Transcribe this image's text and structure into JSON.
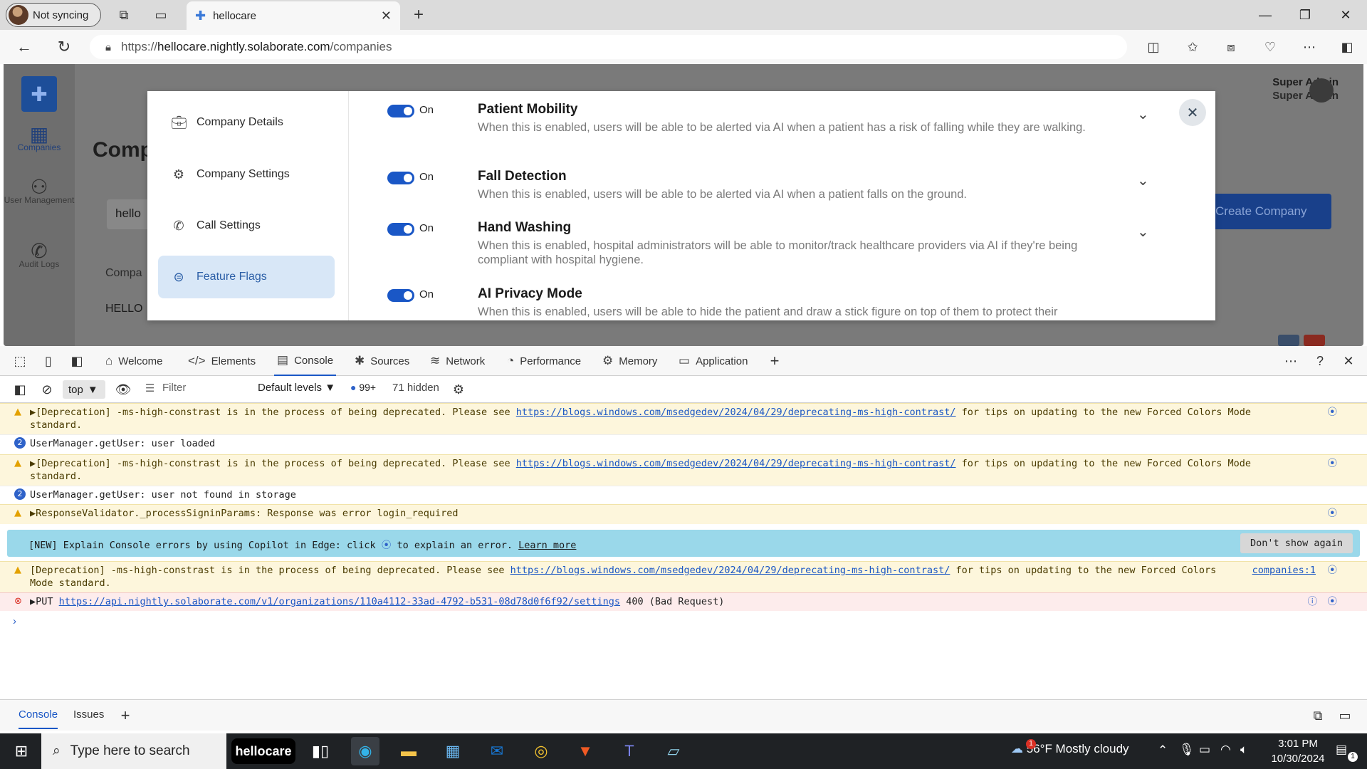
{
  "browser": {
    "profile_label": "Not syncing",
    "tab_title": "hellocare",
    "url_scheme": "https://",
    "url_host": "hellocare.nightly.solaborate.com",
    "url_path": "/companies"
  },
  "app": {
    "nav": [
      {
        "label": "Companies",
        "icon": "building-icon"
      },
      {
        "label": "User Management",
        "icon": "users-icon"
      },
      {
        "label": "Audit Logs",
        "icon": "phone-log-icon"
      }
    ],
    "page_title": "Comp",
    "search_value": "hello",
    "create_button": "Create Company",
    "table_header_fragment": "Compa",
    "row_fragment": "HELLO",
    "user_name": "Super Admin",
    "user_role": "Super Admin"
  },
  "modal": {
    "sidebar": [
      {
        "label": "Company Details",
        "icon": "briefcase-icon",
        "active": false
      },
      {
        "label": "Company Settings",
        "icon": "gear-icon",
        "active": false
      },
      {
        "label": "Call Settings",
        "icon": "phone-icon",
        "active": false
      },
      {
        "label": "Feature Flags",
        "icon": "toggles-icon",
        "active": true
      }
    ],
    "flags": [
      {
        "state": "On",
        "title": "Patient Mobility",
        "description": "When this is enabled, users will be able to be alerted via AI when a patient has a risk of falling while they are walking."
      },
      {
        "state": "On",
        "title": "Fall Detection",
        "description": "When this is enabled, users will be able to be alerted via AI when a patient falls on the ground."
      },
      {
        "state": "On",
        "title": "Hand Washing",
        "description": "When this is enabled, hospital administrators will be able to monitor/track healthcare providers via AI if they're being compliant with hospital hygiene."
      },
      {
        "state": "On",
        "title": "AI Privacy Mode",
        "description": "When this is enabled, users will be able to hide the patient and draw a stick figure on top of them to protect their privacy."
      }
    ]
  },
  "devtools": {
    "tabs": [
      {
        "label": "Welcome",
        "icon": "home-icon"
      },
      {
        "label": "Elements",
        "icon": "code-icon"
      },
      {
        "label": "Console",
        "icon": "console-icon"
      },
      {
        "label": "Sources",
        "icon": "bug-icon"
      },
      {
        "label": "Network",
        "icon": "wifi-icon"
      },
      {
        "label": "Performance",
        "icon": "gauge-icon"
      },
      {
        "label": "Memory",
        "icon": "chip-icon"
      },
      {
        "label": "Application",
        "icon": "window-icon"
      }
    ],
    "toolbar": {
      "context": "top",
      "filter_placeholder": "Filter",
      "levels": "Default levels",
      "message_count": "99+",
      "hidden_count": "71 hidden"
    },
    "logs": {
      "deprecation_text": "[Deprecation] -ms-high-constrast is in the process of being deprecated. Please see",
      "deprecation_link": "https://blogs.windows.com/msedgedev/2024/04/29/deprecating-ms-high-contrast/",
      "deprecation_tail": "for tips on updating to the new Forced Colors Mode standard.",
      "user_loaded": "UserManager.getUser: user loaded",
      "user_not_found": "UserManager.getUser: user not found in storage",
      "validator": "ResponseValidator._processSigninParams: Response was error login_required",
      "banner_text": "[NEW] Explain Console errors by using Copilot in Edge: click",
      "banner_tail": "to explain an error.",
      "banner_link": "Learn more",
      "banner_button": "Don't show again",
      "source_ref": "companies:1",
      "put_method": "PUT",
      "put_url": "https://api.nightly.solaborate.com/v1/organizations/110a4112-33ad-4792-b531-08d78d0f6f92/settings",
      "put_status": "400 (Bad Request)",
      "info_count": "2"
    },
    "drawer_tabs": [
      "Console",
      "Issues"
    ]
  },
  "taskbar": {
    "search_placeholder": "Type here to search",
    "pinned_app": "hellocare",
    "weather": "56°F  Mostly cloudy",
    "time": "3:01 PM",
    "date": "10/30/2024",
    "notification_count": "1",
    "weather_badge": "1"
  },
  "colors": {
    "accent": "#1a57c6",
    "brand": "#1d4e99",
    "warning_bg": "#fdf6dc",
    "error_bg": "#fdecec",
    "banner_bg": "#9ad8ea"
  }
}
